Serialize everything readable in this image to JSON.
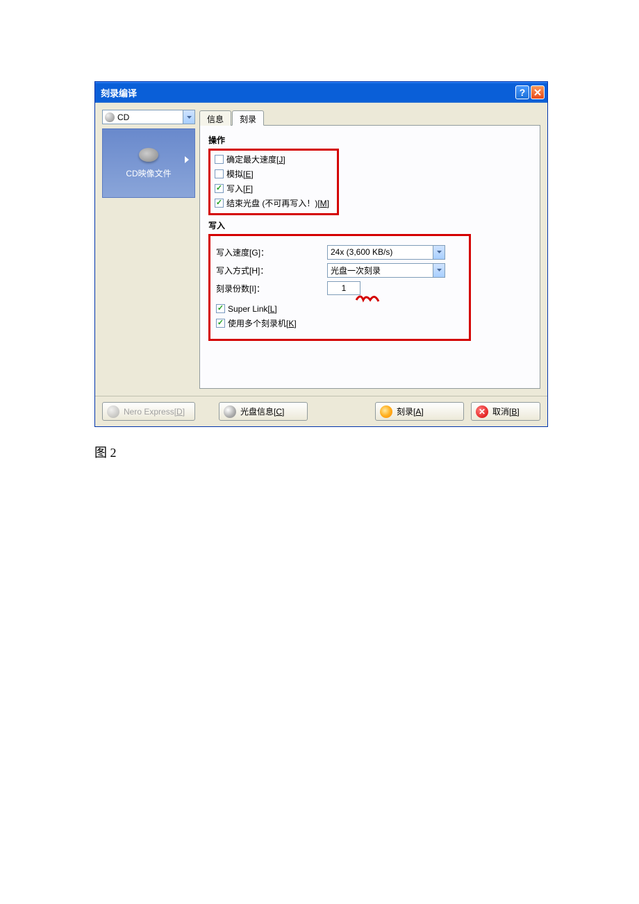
{
  "titlebar": {
    "title": "刻录编译"
  },
  "sidebar": {
    "combo": "CD",
    "tile_label": "CD映像文件"
  },
  "tabs": {
    "info": "信息",
    "burn": "刻录"
  },
  "sections": {
    "operation": "操作",
    "write": "写入"
  },
  "checkboxes": {
    "max_speed": {
      "label": "确定最大速度[",
      "key": "J",
      "suffix": "]"
    },
    "simulate": {
      "label": "模拟[",
      "key": "E",
      "suffix": "]"
    },
    "write": {
      "label": "写入[",
      "key": "F",
      "suffix": "]"
    },
    "finalize": {
      "label": "结束光盘 (不可再写入！)[",
      "key": "M",
      "suffix": "]"
    },
    "superlink": {
      "label": "Super Link[",
      "key": "L",
      "suffix": "]"
    },
    "multi": {
      "label": "使用多个刻录机[",
      "key": "K",
      "suffix": "]"
    }
  },
  "form": {
    "speed_label": {
      "label": "写入速度[",
      "key": "G",
      "suffix": "]："
    },
    "speed_value": "24x (3,600 KB/s)",
    "method_label": {
      "label": "写入方式[",
      "key": "H",
      "suffix": "]："
    },
    "method_value": "光盘一次刻录",
    "copies_label": {
      "label": "刻录份数[",
      "key": "I",
      "suffix": "]："
    },
    "copies_value": "1"
  },
  "buttons": {
    "nero": {
      "label": "Nero Express[",
      "key": "D",
      "suffix": "]"
    },
    "discinfo": {
      "label": "光盘信息[",
      "key": "C",
      "suffix": "]"
    },
    "burn": {
      "label": "刻录[",
      "key": "A",
      "suffix": "]"
    },
    "cancel": {
      "label": "取消[",
      "key": "B",
      "suffix": "]"
    }
  },
  "caption": "图 2"
}
